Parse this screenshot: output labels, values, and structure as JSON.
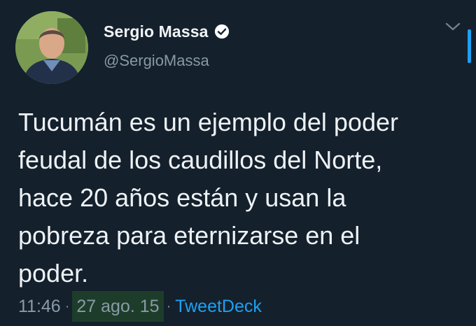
{
  "user": {
    "display_name": "Sergio Massa",
    "handle": "@SergioMassa",
    "verified_icon": "verified-badge-icon",
    "avatar_icon": "profile-photo"
  },
  "tweet": {
    "text": "Tucumán es un ejemplo del poder\nfeudal de los caudillos del Norte,\nhace 20 años están y usan la\npobreza para eternizarse en el\npoder."
  },
  "meta": {
    "time": "11:46",
    "separator": "·",
    "date": "27 ago. 15",
    "source": "TweetDeck"
  },
  "colors": {
    "background": "#14202c",
    "accent": "#1da1f2",
    "secondary_text": "#8899a6",
    "date_highlight": "#1d3d2a"
  },
  "icons": {
    "menu": "chevron-down-icon"
  }
}
